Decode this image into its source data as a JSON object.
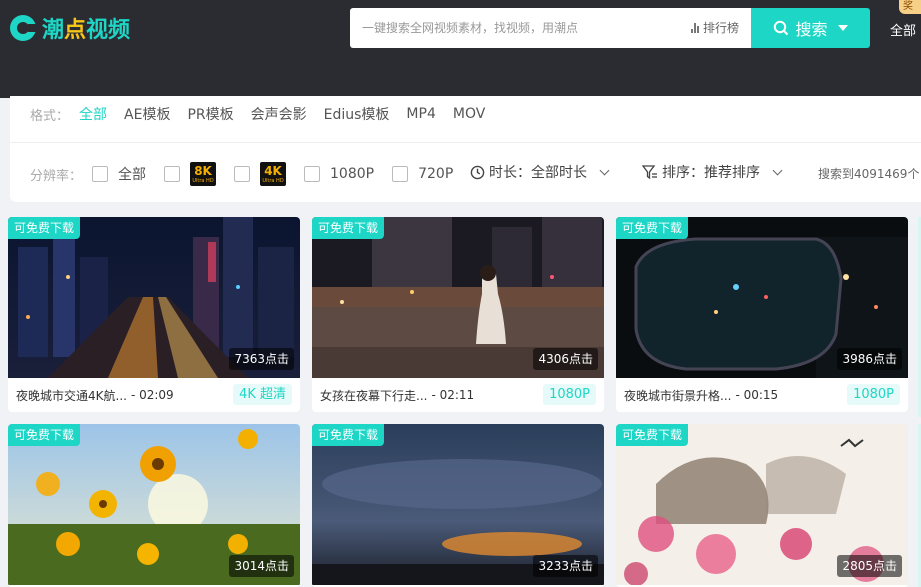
{
  "header": {
    "logo_prefix": "潮",
    "logo_highlight": "点",
    "logo_suffix": "视频",
    "search_placeholder": "一键搜索全网视频素材，找视频，用潮点",
    "rank_label": "排行榜",
    "search_button": "搜索",
    "category_all": "全部",
    "new_badge": "奖"
  },
  "filters": {
    "format_label": "格式：",
    "formats": [
      "全部",
      "AE模板",
      "PR模板",
      "会声会影",
      "Edius模板",
      "MP4",
      "MOV"
    ],
    "resolution_label": "分辨率：",
    "res_all": "全部",
    "res_8k": "8K",
    "res_4k": "4K",
    "res_badge_sub": "Ultra HD",
    "res_1080": "1080P",
    "res_720": "720P",
    "duration": "时长：全部时长",
    "sort": "排序：推荐排序",
    "result_count": "搜索到4091469个"
  },
  "cards": [
    {
      "tag": "可免费下载",
      "clicks": "7363点击",
      "title": "夜晚城市交通4K航...",
      "duration": "- 02:09",
      "quality": "4K 超清"
    },
    {
      "tag": "可免费下载",
      "clicks": "4306点击",
      "title": "女孩在夜幕下行走...",
      "duration": "- 02:11",
      "quality": "1080P"
    },
    {
      "tag": "可免费下载",
      "clicks": "3986点击",
      "title": "夜晚城市街景升格...",
      "duration": "- 00:15",
      "quality": "1080P"
    },
    {
      "tag": "可免费下载",
      "clicks": "3014点击"
    },
    {
      "tag": "可免费下载",
      "clicks": "3233点击"
    },
    {
      "tag": "可免费下载",
      "clicks": "2805点击"
    }
  ],
  "colors": {
    "accent": "#1dd6c6",
    "header_bg": "#2b2c32"
  }
}
